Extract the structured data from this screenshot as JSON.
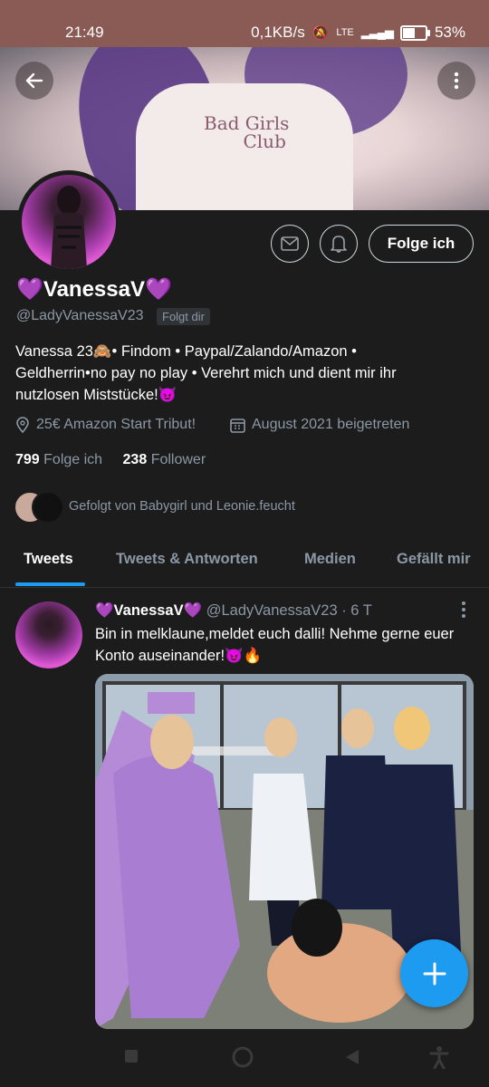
{
  "status": {
    "time": "21:49",
    "speed": "0,1KB/s",
    "network": "LTE",
    "battery": "53%"
  },
  "profile": {
    "name": "💜VanessaV💜",
    "handle": "@LadyVanessaV23",
    "follows_you": "Folgt dir",
    "follow_button": "Folge ich",
    "bio": "Vanessa 23🙈• Findom • Paypal/Zalando/Amazon • Geldherrin•no pay no play • Verehrt mich und dient mir ihr nutzlosen Miststücke!😈",
    "location": "25€ Amazon Start Tribut!",
    "joined": "August 2021 beigetreten",
    "following_count": "799",
    "following_label": "Folge ich",
    "followers_count": "238",
    "followers_label": "Follower",
    "followed_by": "Gefolgt von Babygirl und Leonie.feucht"
  },
  "banner": {
    "shirt_text_1": "Bad Girls",
    "shirt_text_2": "Club"
  },
  "tabs": [
    {
      "label": "Tweets"
    },
    {
      "label": "Tweets & Antworten"
    },
    {
      "label": "Medien"
    },
    {
      "label": "Gefällt mir"
    }
  ],
  "tweet": {
    "name": "💜VanessaV💜",
    "handle": "@LadyVanessaV23",
    "time": "· 6 T",
    "text": "Bin in melklaune,meldet euch dalli! Nehme gerne euer Konto auseinander!😈🔥"
  },
  "icons": {
    "back": "arrow-left-icon",
    "more": "more-vertical-icon",
    "message": "envelope-icon",
    "notify": "bell-icon",
    "location": "location-pin-icon",
    "calendar": "calendar-icon",
    "compose": "plus-icon"
  },
  "colors": {
    "accent": "#1d9bf0",
    "background": "#1c1c1c",
    "muted": "#8b98a5",
    "statusbar": "#8a5a55"
  }
}
